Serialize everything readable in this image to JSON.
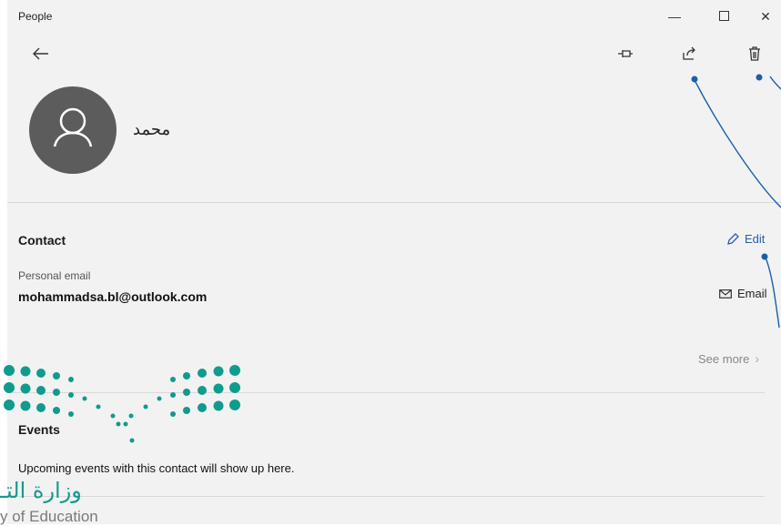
{
  "window": {
    "title": "People"
  },
  "titlebar": {
    "minimize_icon": "minimize-icon",
    "maximize_icon": "maximize-icon",
    "close_icon": "close-icon"
  },
  "cmdbar": {
    "back_icon": "back-arrow-icon",
    "pin_icon": "pin-icon",
    "share_icon": "share-icon",
    "delete_icon": "trash-icon"
  },
  "contact": {
    "name": "محمد"
  },
  "contact_section": {
    "title": "Contact",
    "edit_label": "Edit",
    "email_label": "Personal email",
    "email_value": "mohammadsa.bl@outlook.com",
    "email_action": "Email",
    "see_more": "See more"
  },
  "events_section": {
    "title": "Events",
    "empty_text": "Upcoming events with this contact will show up here."
  },
  "watermark": {
    "arabic": "وزارة التـ",
    "english": "y of Education"
  },
  "colors": {
    "accent": "#2a5ea9",
    "callout": "#1a5fa8",
    "logo_green": "#159a8e"
  }
}
